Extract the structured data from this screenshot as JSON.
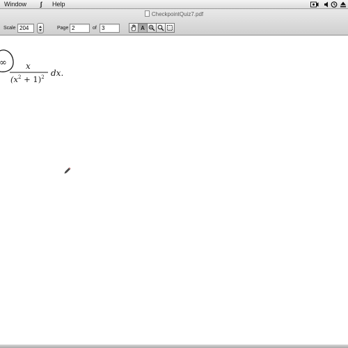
{
  "menubar": {
    "items": [
      {
        "label": "Window"
      },
      {
        "label": "Help"
      }
    ],
    "script_glyph": "ʃ"
  },
  "window": {
    "title": "CheckpointQuiz7.pdf"
  },
  "toolbar": {
    "scale_label": "Scale",
    "scale_value": "204",
    "page_label": "Page",
    "page_value": "2",
    "of_label": "of",
    "page_total": "3",
    "tools": [
      {
        "icon": "hand-icon",
        "active": false
      },
      {
        "icon": "text-select-icon",
        "label": "A",
        "active": true
      },
      {
        "icon": "zoom-in-icon",
        "active": false
      },
      {
        "icon": "zoom-out-icon",
        "active": false
      },
      {
        "icon": "marquee-select-icon",
        "active": false
      }
    ]
  },
  "document": {
    "formula": {
      "numerator": "x",
      "denominator_base": "(x",
      "denominator_exp": "2",
      "denominator_mid": " + 1)",
      "denominator_exp2": "2",
      "differential": "dx.",
      "circled_symbol": "∞"
    }
  },
  "colors": {
    "menubar": "#e5e5e5",
    "toolbar": "#d9d9d9",
    "page": "#ffffff",
    "ink": "#1a1a1a"
  }
}
